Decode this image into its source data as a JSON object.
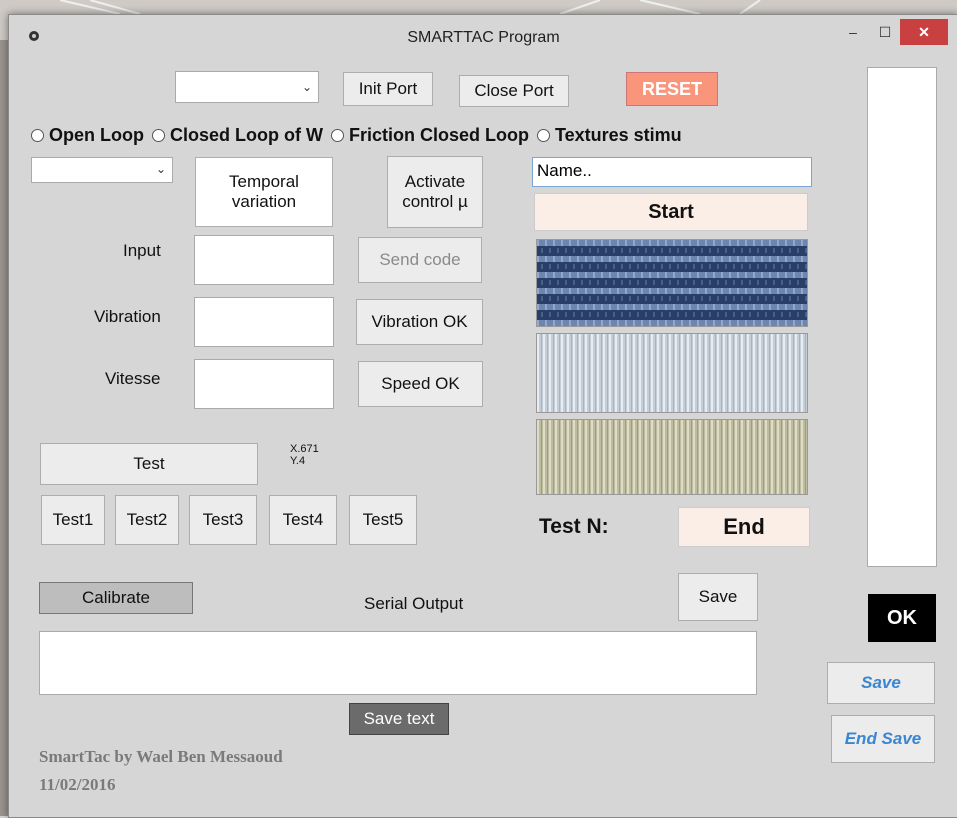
{
  "window": {
    "title": "SMARTTAC Program"
  },
  "port": {
    "selected": "",
    "init_label": "Init Port",
    "close_label": "Close Port",
    "reset_label": "RESET"
  },
  "modes": [
    {
      "label": "Open Loop"
    },
    {
      "label": "Closed Loop of W"
    },
    {
      "label": "Friction Closed Loop"
    },
    {
      "label": "Textures stimu"
    }
  ],
  "controls": {
    "left_select": "",
    "temporal_line1": "Temporal",
    "temporal_line2": "variation",
    "activate_line1": "Activate",
    "activate_line2": "control µ",
    "input_label": "Input",
    "vibration_label": "Vibration",
    "vitesse_label": "Vitesse",
    "send_code": "Send code",
    "vibration_ok": "Vibration OK",
    "speed_ok": "Speed OK"
  },
  "tests": {
    "test_label": "Test",
    "coords_x": "X.671",
    "coords_y": "Y.4",
    "buttons": [
      "Test1",
      "Test2",
      "Test3",
      "Test4",
      "Test5"
    ]
  },
  "experiment": {
    "name_value": "Name..",
    "start_label": "Start",
    "test_n_label": "Test N:",
    "end_label": "End"
  },
  "serial": {
    "calibrate_label": "Calibrate",
    "title": "Serial Output",
    "save_label": "Save",
    "output_value": "",
    "save_text_label": "Save text"
  },
  "side": {
    "ok_label": "OK",
    "save_label": "Save",
    "end_save_label": "End Save"
  },
  "footer": {
    "author": "SmartTac by Wael Ben Messaoud",
    "date": "11/02/2016"
  },
  "colors": {
    "reset_bg": "#f8957a",
    "start_bg": "#fbeee6",
    "close_bg": "#c84040",
    "link_blue": "#3a86d1"
  }
}
